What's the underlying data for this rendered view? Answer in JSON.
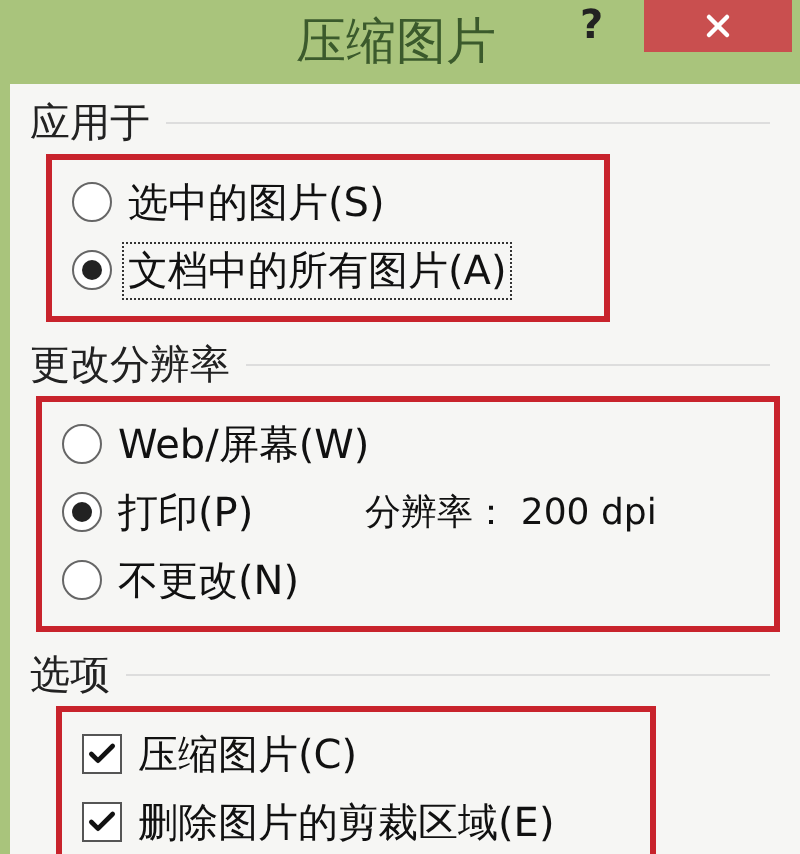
{
  "window": {
    "title": "压缩图片",
    "help_button": "?"
  },
  "sections": [
    {
      "heading": "应用于",
      "highlighted": true,
      "kind": "radio",
      "options": [
        {
          "label": "选中的图片(S)",
          "selected": false,
          "focused": false
        },
        {
          "label": "文档中的所有图片(A)",
          "selected": true,
          "focused": true
        }
      ]
    },
    {
      "heading": "更改分辨率",
      "highlighted": true,
      "kind": "radio",
      "options": [
        {
          "label": "Web/屏幕(W)",
          "selected": false,
          "focused": false
        },
        {
          "label": "打印(P)",
          "selected": true,
          "focused": false,
          "note": "分辨率： 200 dpi"
        },
        {
          "label": "不更改(N)",
          "selected": false,
          "focused": false
        }
      ]
    },
    {
      "heading": "选项",
      "highlighted": true,
      "kind": "checkbox",
      "options": [
        {
          "label": "压缩图片(C)",
          "checked": true
        },
        {
          "label": "删除图片的剪裁区域(E)",
          "checked": true
        }
      ]
    }
  ]
}
